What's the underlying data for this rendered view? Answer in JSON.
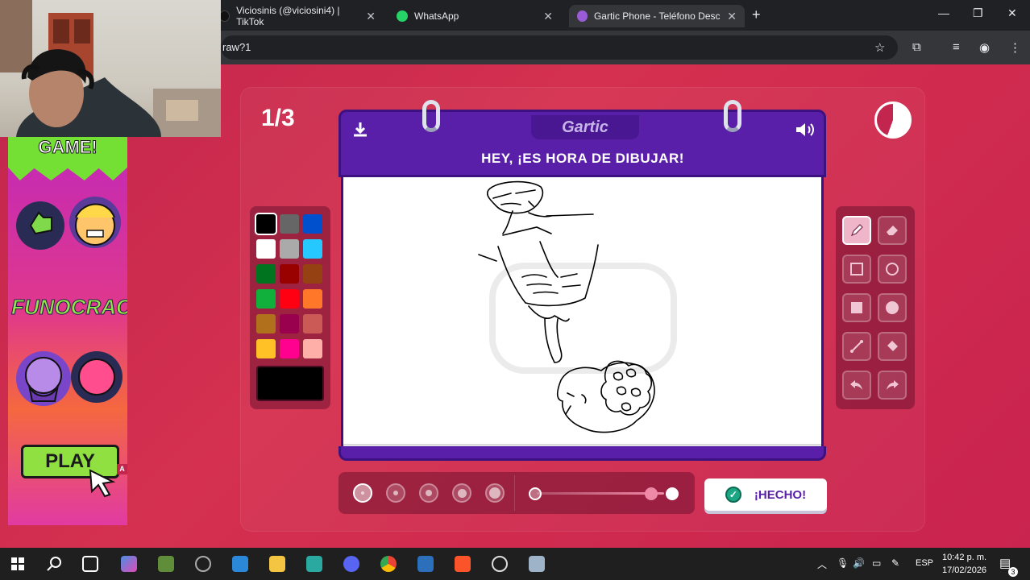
{
  "browser": {
    "tabs": [
      {
        "title": "Viciosinis (@viciosini4) | TikTok",
        "icon": "tiktok-icon"
      },
      {
        "title": "WhatsApp",
        "icon": "whatsapp-icon"
      },
      {
        "title": "Gartic Phone - Teléfono Descon",
        "icon": "gartic-icon"
      }
    ],
    "url": "raw?1"
  },
  "game": {
    "round": "1/3",
    "logo": "Gartic",
    "instruction": "HEY, ¡ES HORA DE DIBUJAR!",
    "done_label": "¡HECHO!",
    "selected_color": "#000000",
    "palette": [
      "#000000",
      "#666666",
      "#0050cd",
      "#ffffff",
      "#aaaaaa",
      "#26c9ff",
      "#017420",
      "#990000",
      "#964112",
      "#11b03c",
      "#ff0013",
      "#ff7829",
      "#b0701c",
      "#99004e",
      "#cb5a57",
      "#ffc126",
      "#ff008f",
      "#feafa8"
    ],
    "tools": [
      "pencil-icon",
      "eraser-icon",
      "square-outline-icon",
      "circle-outline-icon",
      "square-filled-icon",
      "circle-filled-icon",
      "line-icon",
      "fill-bucket-icon",
      "undo-icon",
      "redo-icon"
    ],
    "selected_tool": "pencil-icon",
    "brush_sizes": 5,
    "selected_brush_size": 1,
    "opacity": 1.0
  },
  "ad": {
    "headline": "GAME!",
    "brand": "FUNOCRACY",
    "cta": "PLAY",
    "badge": "A"
  },
  "taskbar": {
    "language": "ESP",
    "time": "10:42 p. m.",
    "date": "17/02/2026",
    "notifications": "3"
  }
}
